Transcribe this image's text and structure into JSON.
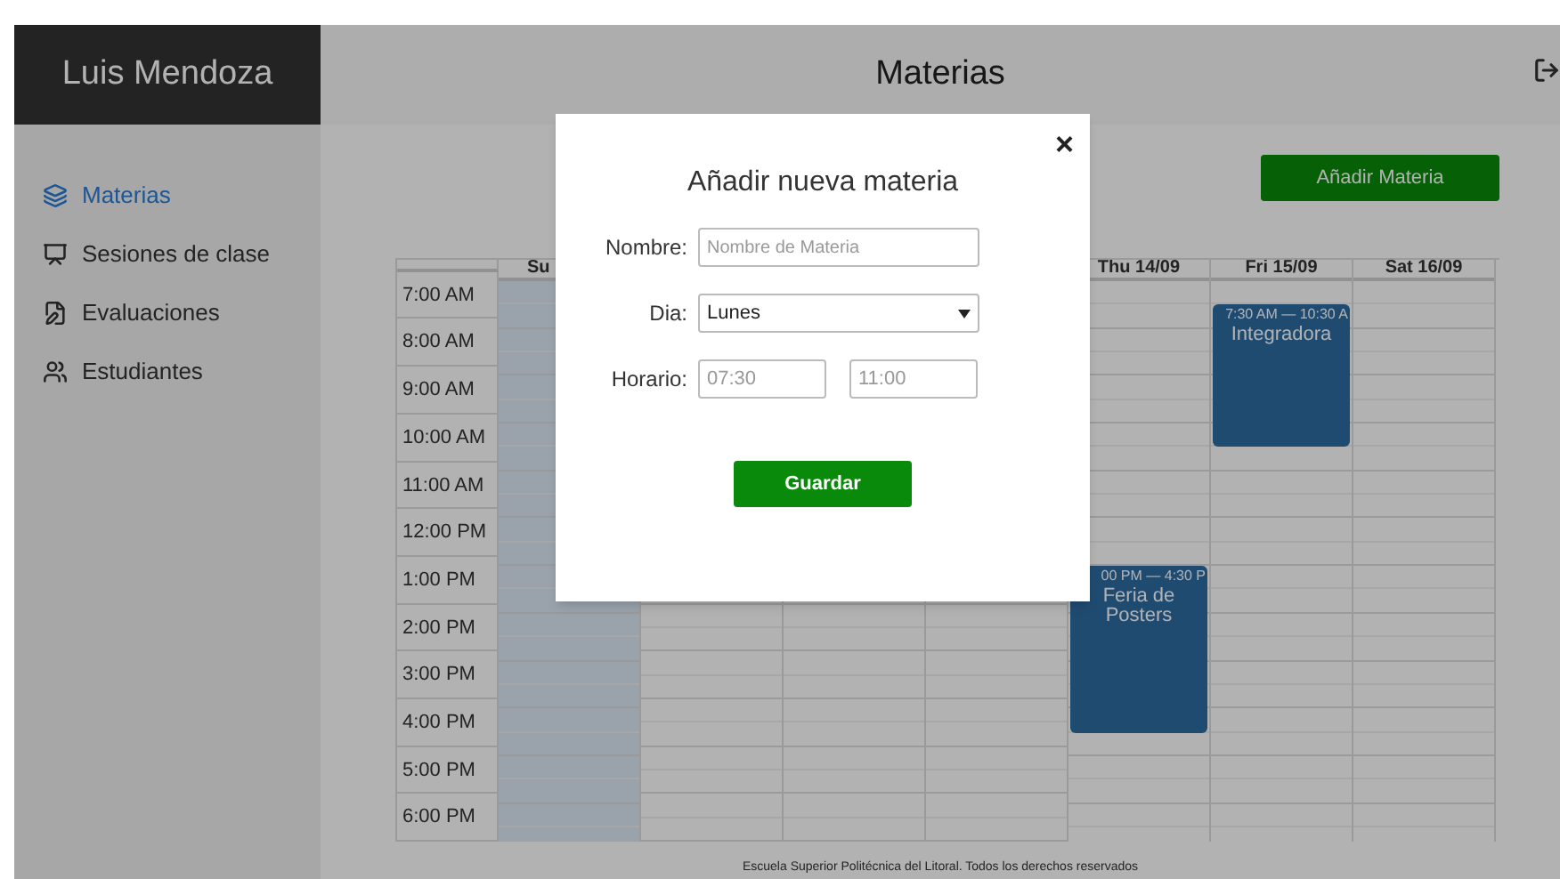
{
  "sidebar": {
    "user": "Luis Mendoza",
    "items": [
      {
        "label": "Materias",
        "selected": true
      },
      {
        "label": "Sesiones de clase",
        "selected": false
      },
      {
        "label": "Evaluaciones",
        "selected": false
      },
      {
        "label": "Estudiantes",
        "selected": false
      }
    ]
  },
  "header": {
    "title": "Materias"
  },
  "add_button": "Añadir Materia",
  "calendar": {
    "days": [
      {
        "label": "Su",
        "today": true
      },
      {
        "today": false
      },
      {
        "today": false
      },
      {
        "today": false
      },
      {
        "label": "Thu 14/09",
        "today": false,
        "events": [
          {
            "time": "00 PM — 4:30 P",
            "title": "Feria de Posters"
          }
        ]
      },
      {
        "label": "Fri 15/09",
        "today": false,
        "events": [
          {
            "time": "7:30 AM — 10:30 A",
            "title": "Integradora"
          }
        ]
      },
      {
        "label": "Sat 16/09",
        "today": false
      }
    ],
    "times": [
      "7:00 AM",
      "8:00 AM",
      "9:00 AM",
      "10:00 AM",
      "11:00 AM",
      "12:00 PM",
      "1:00 PM",
      "2:00 PM",
      "3:00 PM",
      "4:00 PM",
      "5:00 PM",
      "6:00 PM"
    ]
  },
  "footer": "Escuela Superior Politécnica del Litoral. Todos los derechos reservados",
  "modal": {
    "close": "×",
    "title": "Añadir nueva materia",
    "fields": [
      {
        "kind": "text",
        "label": "Nombre:",
        "placeholder": "Nombre de Materia"
      },
      {
        "kind": "select",
        "label": "Dia:",
        "value": "Lunes"
      },
      {
        "kind": "times",
        "label": "Horario:",
        "placeholders": [
          "07:30",
          "11:00"
        ]
      }
    ],
    "submit": "Guardar"
  }
}
